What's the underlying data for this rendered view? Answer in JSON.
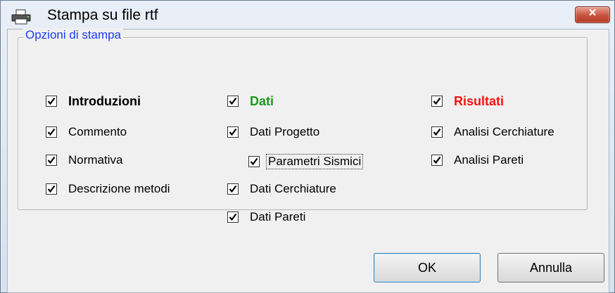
{
  "window": {
    "title": "Stampa su file rtf",
    "close_label": "×"
  },
  "group": {
    "title": "Opzioni di stampa",
    "columns": [
      {
        "header": {
          "label": "Introduzioni",
          "checked": true
        },
        "items": [
          {
            "label": "Commento",
            "checked": true
          },
          {
            "label": "Normativa",
            "checked": true
          },
          {
            "label": "Descrizione metodi",
            "checked": true
          }
        ]
      },
      {
        "header": {
          "label": "Dati",
          "checked": true
        },
        "items": [
          {
            "label": "Dati Progetto",
            "checked": true
          },
          {
            "label": "Parametri Sismici",
            "checked": true
          },
          {
            "label": "Dati Cerchiature",
            "checked": true
          },
          {
            "label": "Dati Pareti",
            "checked": true
          }
        ]
      },
      {
        "header": {
          "label": "Risultati",
          "checked": true
        },
        "items": [
          {
            "label": "Analisi Cerchiature",
            "checked": true
          },
          {
            "label": "Analisi Pareti",
            "checked": true
          }
        ]
      }
    ]
  },
  "buttons": {
    "ok_label": "OK",
    "cancel_label": "Annulla"
  },
  "colors": {
    "group_title": "#1a3cff",
    "dati": "#1e9a1e",
    "risultati": "#ff1010"
  }
}
